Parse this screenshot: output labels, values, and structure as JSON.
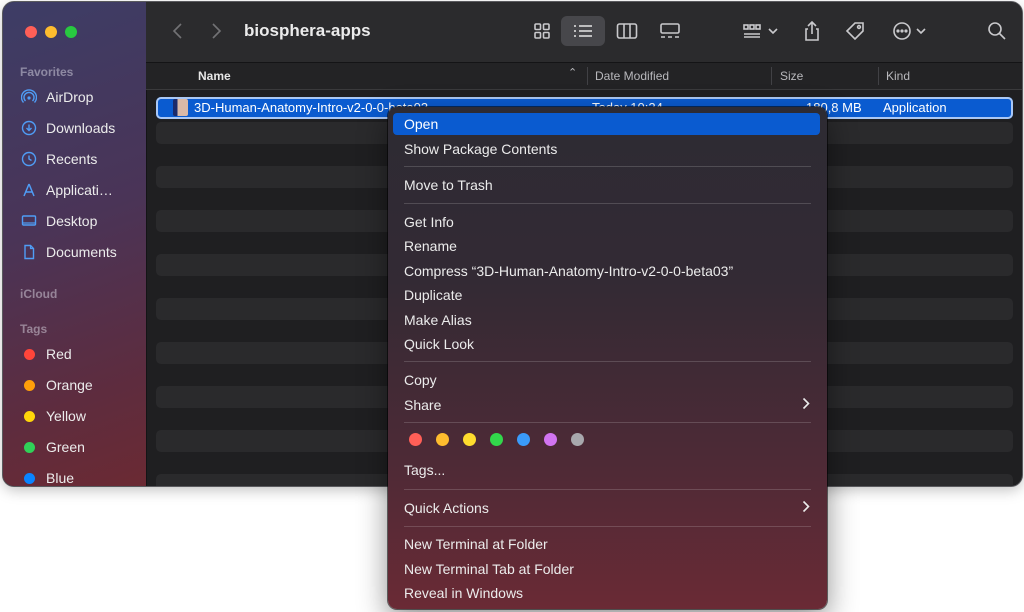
{
  "window": {
    "title": "biosphera-apps"
  },
  "sidebar": {
    "favorites_header": "Favorites",
    "favorites": [
      {
        "label": "AirDrop",
        "icon": "airdrop-icon"
      },
      {
        "label": "Downloads",
        "icon": "downloads-icon"
      },
      {
        "label": "Recents",
        "icon": "recents-icon"
      },
      {
        "label": "Applicati…",
        "icon": "applications-icon"
      },
      {
        "label": "Desktop",
        "icon": "desktop-icon"
      },
      {
        "label": "Documents",
        "icon": "documents-icon"
      }
    ],
    "icloud_header": "iCloud",
    "tags_header": "Tags",
    "tags": [
      {
        "label": "Red",
        "color": "#ff453a"
      },
      {
        "label": "Orange",
        "color": "#ff9f0a"
      },
      {
        "label": "Yellow",
        "color": "#ffd60a"
      },
      {
        "label": "Green",
        "color": "#30d158"
      },
      {
        "label": "Blue",
        "color": "#0a84ff"
      }
    ]
  },
  "columns": {
    "name": "Name",
    "date_modified": "Date Modified",
    "size": "Size",
    "kind": "Kind"
  },
  "files": [
    {
      "name": "3D-Human-Anatomy-Intro-v2-0-0-beta03",
      "date_modified": "Today 10:24",
      "size": "180,8 MB",
      "kind": "Application"
    }
  ],
  "context_menu": {
    "open": "Open",
    "show_package_contents": "Show Package Contents",
    "move_to_trash": "Move to Trash",
    "get_info": "Get Info",
    "rename": "Rename",
    "compress": "Compress “3D-Human-Anatomy-Intro-v2-0-0-beta03”",
    "duplicate": "Duplicate",
    "make_alias": "Make Alias",
    "quick_look": "Quick Look",
    "copy": "Copy",
    "share": "Share",
    "tag_colors": [
      "#ff5f57",
      "#febc2e",
      "#fedc2e",
      "#32d74b",
      "#3a9bfa",
      "#d174f0",
      "#a8a8ad"
    ],
    "tags": "Tags...",
    "quick_actions": "Quick Actions",
    "new_terminal_at_folder": "New Terminal at Folder",
    "new_terminal_tab_at_folder": "New Terminal Tab at Folder",
    "reveal_in_windows": "Reveal in Windows"
  }
}
